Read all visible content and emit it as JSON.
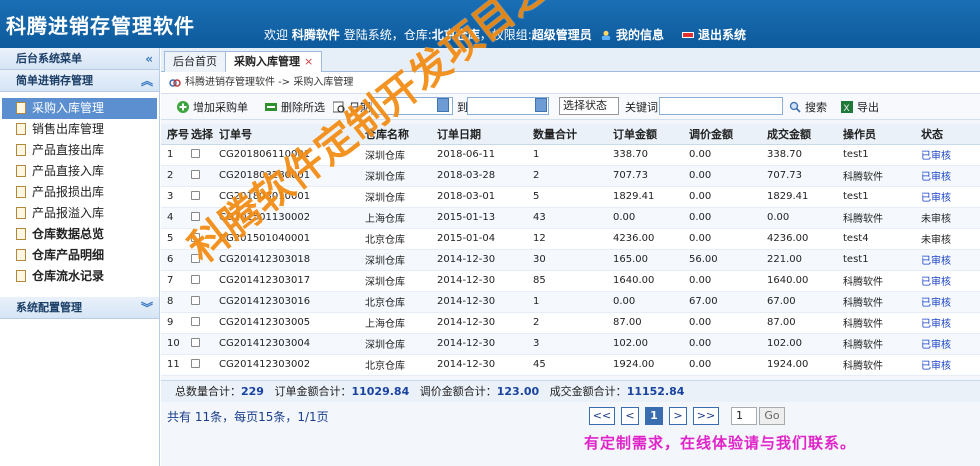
{
  "header": {
    "logo": "科腾进销存管理软件",
    "welcome_prefix": "欢迎",
    "user": "科腾软件",
    "mid1": "登陆系统，仓库:",
    "warehouse": "北京仓库",
    "mid2": "，权限组:",
    "role": "超级管理员",
    "my_info": "我的信息",
    "logout": "退出系统"
  },
  "sidebar": {
    "title": "后台系统菜单",
    "section1": "简单进销存管理",
    "items": [
      {
        "label": "采购入库管理"
      },
      {
        "label": "销售出库管理"
      },
      {
        "label": "产品直接出库"
      },
      {
        "label": "产品直接入库"
      },
      {
        "label": "产品报损出库"
      },
      {
        "label": "产品报溢入库"
      },
      {
        "label": "仓库数据总览"
      },
      {
        "label": "仓库产品明细"
      },
      {
        "label": "仓库流水记录"
      }
    ],
    "section2": "系统配置管理"
  },
  "tabs": [
    {
      "label": "后台首页"
    },
    {
      "label": "采购入库管理",
      "close": "×"
    }
  ],
  "breadcrumb": "科腾进销存管理软件 -> 采购入库管理",
  "toolbar": {
    "add": "增加采购单",
    "delete": "删除所选",
    "date_label": "日期:",
    "to_label": "到",
    "status_select": "选择状态",
    "keyword_label": "关键词:",
    "search": "搜索",
    "export": "导出"
  },
  "table": {
    "headers": [
      "序号",
      "选择",
      "订单号",
      "仓库名称",
      "订单日期",
      "数量合计",
      "订单金额",
      "调价金额",
      "成交金额",
      "操作员",
      "状态"
    ],
    "rows": [
      [
        "1",
        "CG201806110001",
        "深圳仓库",
        "2018-06-11",
        "1",
        "338.70",
        "0.00",
        "338.70",
        "test1",
        "已审核"
      ],
      [
        "2",
        "CG201803280001",
        "深圳仓库",
        "2018-03-28",
        "2",
        "707.73",
        "0.00",
        "707.73",
        "科腾软件",
        "已审核"
      ],
      [
        "3",
        "CG201803010001",
        "深圳仓库",
        "2018-03-01",
        "5",
        "1829.41",
        "0.00",
        "1829.41",
        "test1",
        "已审核"
      ],
      [
        "4",
        "CG201501130002",
        "上海仓库",
        "2015-01-13",
        "43",
        "0.00",
        "0.00",
        "0.00",
        "科腾软件",
        "未审核"
      ],
      [
        "5",
        "CG201501040001",
        "北京仓库",
        "2015-01-04",
        "12",
        "4236.00",
        "0.00",
        "4236.00",
        "test4",
        "未审核"
      ],
      [
        "6",
        "CG201412303018",
        "深圳仓库",
        "2014-12-30",
        "30",
        "165.00",
        "56.00",
        "221.00",
        "test1",
        "已审核"
      ],
      [
        "7",
        "CG201412303017",
        "深圳仓库",
        "2014-12-30",
        "85",
        "1640.00",
        "0.00",
        "1640.00",
        "科腾软件",
        "已审核"
      ],
      [
        "8",
        "CG201412303016",
        "北京仓库",
        "2014-12-30",
        "1",
        "0.00",
        "67.00",
        "67.00",
        "科腾软件",
        "已审核"
      ],
      [
        "9",
        "CG201412303005",
        "上海仓库",
        "2014-12-30",
        "2",
        "87.00",
        "0.00",
        "87.00",
        "科腾软件",
        "已审核"
      ],
      [
        "10",
        "CG201412303004",
        "深圳仓库",
        "2014-12-30",
        "3",
        "102.00",
        "0.00",
        "102.00",
        "科腾软件",
        "已审核"
      ],
      [
        "11",
        "CG201412303002",
        "北京仓库",
        "2014-12-30",
        "45",
        "1924.00",
        "0.00",
        "1924.00",
        "科腾软件",
        "已审核"
      ]
    ]
  },
  "summary": {
    "qty_label": "总数量合计：",
    "qty": "229",
    "order_label": "订单金额合计：",
    "order": "11029.84",
    "adjust_label": "调价金额合计：",
    "adjust": "123.00",
    "deal_label": "成交金额合计：",
    "deal": "11152.84"
  },
  "pager": {
    "info": "共有 11条，每页15条，1/1页",
    "first": "<<",
    "prev": "<",
    "current": "1",
    "next": ">",
    "last": ">>",
    "page_input": "1",
    "go": "Go"
  },
  "promo": "有定制需求，在线体验请与我们联系。",
  "watermark": "科腾软件定制开发项目之一"
}
